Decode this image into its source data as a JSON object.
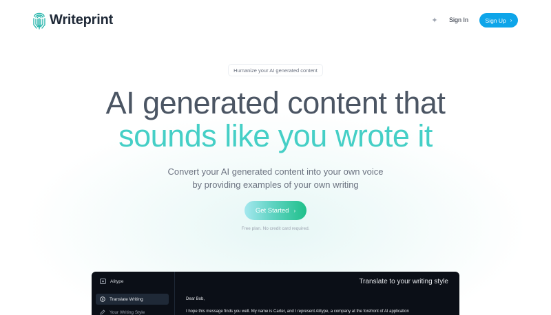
{
  "header": {
    "brand": "Writeprint",
    "sign_in": "Sign In",
    "sign_up": "Sign Up",
    "theme_icon": "sparkle-icon"
  },
  "hero": {
    "badge": "Humanize your AI generated content",
    "headline_line1": "AI generated content that",
    "headline_line2": "sounds like you wrote it",
    "subtitle_line1": "Convert your AI generated content into your own voice",
    "subtitle_line2": "by providing examples of your own writing",
    "cta": "Get Started",
    "note": "Free plan. No credit card required."
  },
  "app_preview": {
    "brand": "Alitype",
    "nav": [
      {
        "label": "Translate Writing",
        "active": true,
        "icon": "circle-arrow-icon"
      },
      {
        "label": "Your Writing Style",
        "active": false,
        "icon": "pen-icon"
      }
    ],
    "title": "Translate to your writing style",
    "greeting": "Dear Bob,",
    "body": "I hope this message finds you well. My name is Carter, and I represent Alitype, a company at the forefront of AI application"
  },
  "colors": {
    "accent_teal": "#45cfc6",
    "sign_up_blue": "#0ea5e9",
    "cta_gradient_start": "#a5e8ef",
    "cta_gradient_end": "#20c08a",
    "app_bg": "#0b0f17"
  }
}
